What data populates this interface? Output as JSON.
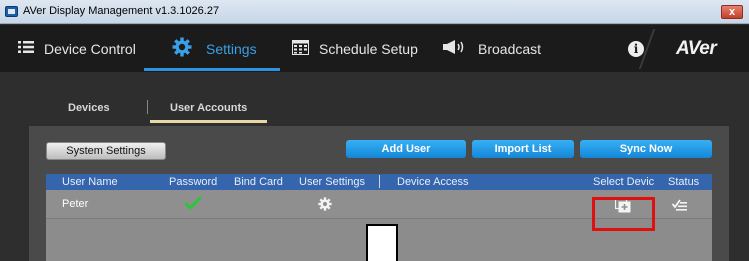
{
  "window": {
    "title": "AVer Display Management v1.3.1026.27",
    "close_label": "x"
  },
  "nav": {
    "items": [
      {
        "label": "Device Control",
        "icon": "list-icon"
      },
      {
        "label": "Settings",
        "icon": "gear-icon"
      },
      {
        "label": "Schedule Setup",
        "icon": "calendar-icon"
      },
      {
        "label": "Broadcast",
        "icon": "megaphone-icon"
      }
    ],
    "active": "Settings",
    "info_label": "i",
    "brand": "AVer",
    "accent_color": "#2d95e0"
  },
  "subtabs": {
    "items": [
      "Devices",
      "User Accounts"
    ],
    "active": "User Accounts"
  },
  "toolbar": {
    "system_settings": "System Settings",
    "add_user": "Add User",
    "import_list": "Import List",
    "sync_now": "Sync Now"
  },
  "table": {
    "columns": [
      "User Name",
      "Password",
      "Bind Card",
      "User Settings",
      "Device Access",
      "Select Devic",
      "Status"
    ],
    "rows": [
      {
        "user_name": "Peter",
        "password": "check-icon",
        "user_settings": "gear-icon",
        "select_device": "select-device-icon",
        "status": "status-icon"
      }
    ]
  }
}
